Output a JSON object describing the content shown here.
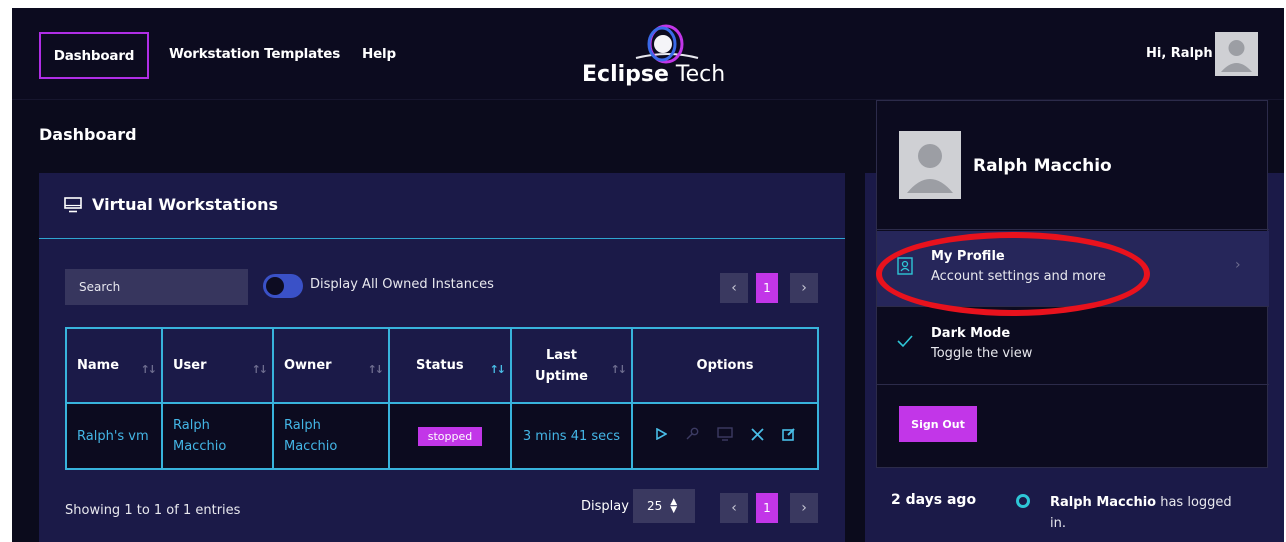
{
  "nav": {
    "dashboard": "Dashboard",
    "templates": "Workstation Templates",
    "help": "Help"
  },
  "brand": {
    "name_bold": "Eclipse",
    "name_light": " Tech"
  },
  "user": {
    "greeting": "Hi, Ralph",
    "full_name": "Ralph Macchio"
  },
  "page": {
    "title": "Dashboard"
  },
  "workstations": {
    "title": "Virtual Workstations",
    "search_placeholder": "Search",
    "toggle_label": "Display All Owned Instances",
    "page_number": "1",
    "columns": [
      "Name",
      "User",
      "Owner",
      "Status",
      "Last Uptime",
      "Options"
    ],
    "rows": [
      {
        "name": "Ralph's vm",
        "user": "Ralph Macchio",
        "owner": "Ralph Macchio",
        "status": "stopped",
        "uptime": "3 mins 41 secs"
      }
    ],
    "footer_info": "Showing 1 to 1 of 1 entries",
    "display_label": "Display",
    "display_value": "25"
  },
  "menu": {
    "profile_title": "My Profile",
    "profile_sub": "Account settings and more",
    "dark_title": "Dark Mode",
    "dark_sub": "Toggle the view",
    "signout": "Sign Out"
  },
  "activity": {
    "time": "2 days ago",
    "actor": "Ralph Macchio",
    "text": " has logged in."
  },
  "colors": {
    "accent": "#c236e8",
    "border": "#38b3dc",
    "annotation": "#e8121d"
  }
}
